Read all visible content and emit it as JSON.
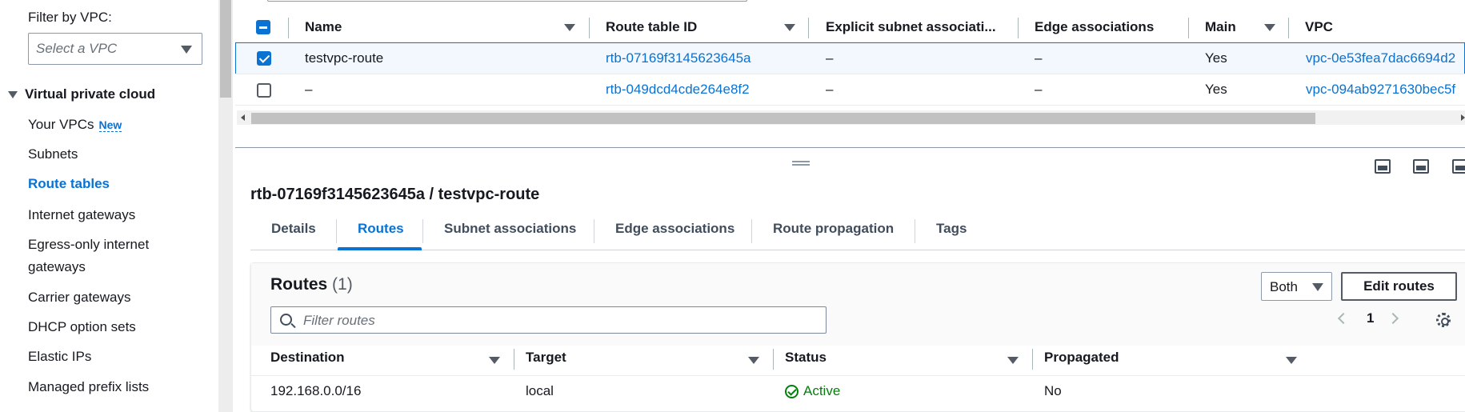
{
  "sidebar": {
    "filter_label": "Filter by VPC:",
    "filter_placeholder": "Select a VPC",
    "section": "Virtual private cloud",
    "items": [
      {
        "label": "Your VPCs",
        "badge": "New"
      },
      {
        "label": "Subnets"
      },
      {
        "label": "Route tables",
        "active": true
      },
      {
        "label": "Internet gateways"
      },
      {
        "label": "Egress-only internet",
        "label2": "gateways"
      },
      {
        "label": "Carrier gateways"
      },
      {
        "label": "DHCP option sets"
      },
      {
        "label": "Elastic IPs"
      },
      {
        "label": "Managed prefix lists"
      }
    ]
  },
  "route_tables": {
    "columns": [
      "Name",
      "Route table ID",
      "Explicit subnet associati...",
      "Edge associations",
      "Main",
      "VPC"
    ],
    "rows": [
      {
        "name": "testvpc-route",
        "id": "rtb-07169f3145623645a",
        "explicit": "–",
        "edge": "–",
        "main": "Yes",
        "vpc": "vpc-0e53fea7dac6694d2",
        "selected": true
      },
      {
        "name": "–",
        "id": "rtb-049dcd4cde264e8f2",
        "explicit": "–",
        "edge": "–",
        "main": "Yes",
        "vpc": "vpc-094ab9271630bec5f",
        "selected": false
      }
    ]
  },
  "detail": {
    "title": "rtb-07169f3145623645a / testvpc-route",
    "tabs": [
      "Details",
      "Routes",
      "Subnet associations",
      "Edge associations",
      "Route propagation",
      "Tags"
    ],
    "active_tab": "Routes"
  },
  "routes": {
    "title": "Routes",
    "count": "(1)",
    "filter_placeholder": "Filter routes",
    "view_select": "Both",
    "edit_button": "Edit routes",
    "page": "1",
    "columns": [
      "Destination",
      "Target",
      "Status",
      "Propagated"
    ],
    "rows": [
      {
        "destination": "192.168.0.0/16",
        "target": "local",
        "status": "Active",
        "propagated": "No"
      }
    ]
  },
  "colors": {
    "accent": "#0972d3",
    "success": "#037f0c",
    "text": "#16191f"
  }
}
